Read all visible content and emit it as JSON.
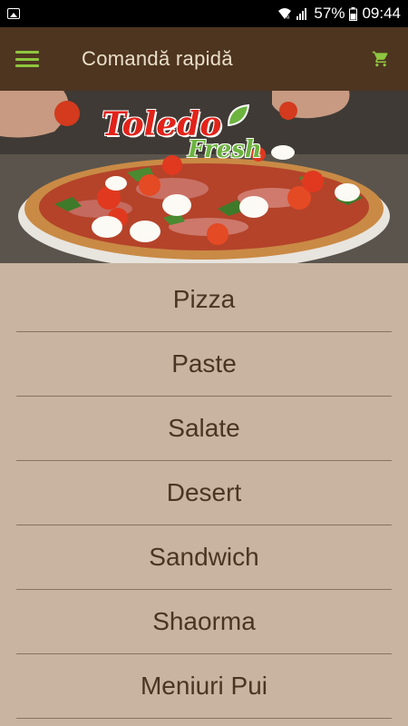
{
  "status_bar": {
    "battery": "57%",
    "time": "09:44"
  },
  "app_bar": {
    "title": "Comandă rapidă",
    "menu_icon": "hamburger-menu-icon",
    "cart_icon": "shopping-cart-icon"
  },
  "hero": {
    "logo_main": "Toledo",
    "logo_sub": "Fresh"
  },
  "categories": [
    {
      "label": "Pizza"
    },
    {
      "label": "Paste"
    },
    {
      "label": "Salate"
    },
    {
      "label": "Desert"
    },
    {
      "label": "Sandwich"
    },
    {
      "label": "Shaorma"
    },
    {
      "label": "Meniuri Pui"
    }
  ],
  "colors": {
    "app_bar": "#4e3520",
    "accent_green": "#8ec63f",
    "background": "#c8b4a0",
    "menu_text": "#4a3524"
  }
}
